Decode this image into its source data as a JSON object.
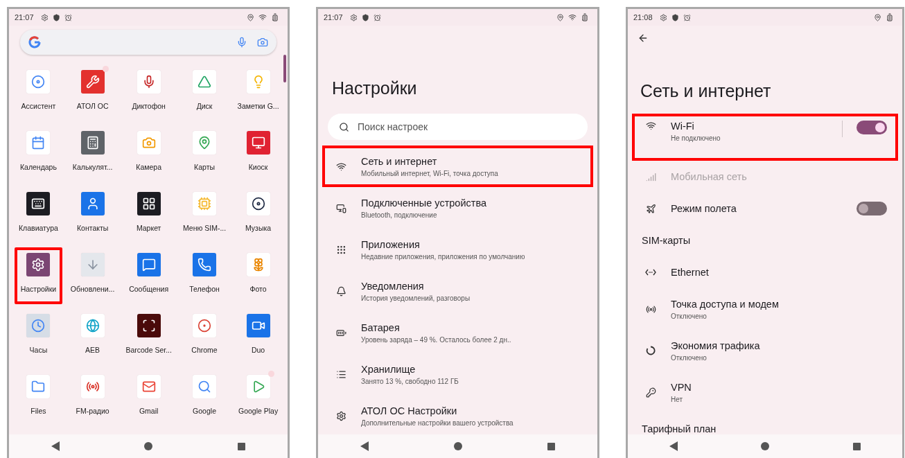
{
  "screens": [
    {
      "kind": "launcher",
      "status_bar": {
        "time": "21:07",
        "wifi": true
      },
      "scrollbar": true,
      "apps": [
        {
          "label": "Ассистент",
          "highlighted": false,
          "dot": false
        },
        {
          "label": "АТОЛ ОС",
          "highlighted": false,
          "dot": true
        },
        {
          "label": "Диктофон",
          "highlighted": false,
          "dot": false
        },
        {
          "label": "Диск",
          "highlighted": false,
          "dot": false
        },
        {
          "label": "Заметки G...",
          "highlighted": false,
          "dot": false
        },
        {
          "label": "Календарь",
          "highlighted": false,
          "dot": false
        },
        {
          "label": "Калькулят...",
          "highlighted": false,
          "dot": false
        },
        {
          "label": "Камера",
          "highlighted": false,
          "dot": false
        },
        {
          "label": "Карты",
          "highlighted": false,
          "dot": false
        },
        {
          "label": "Киоск",
          "highlighted": false,
          "dot": false
        },
        {
          "label": "Клавиатура",
          "highlighted": false,
          "dot": false
        },
        {
          "label": "Контакты",
          "highlighted": false,
          "dot": false
        },
        {
          "label": "Маркет",
          "highlighted": false,
          "dot": false
        },
        {
          "label": "Меню SIM-...",
          "highlighted": false,
          "dot": false
        },
        {
          "label": "Музыка",
          "highlighted": false,
          "dot": false
        },
        {
          "label": "Настройки",
          "highlighted": true,
          "dot": false
        },
        {
          "label": "Обновлени...",
          "highlighted": false,
          "dot": false
        },
        {
          "label": "Сообщения",
          "highlighted": false,
          "dot": false
        },
        {
          "label": "Телефон",
          "highlighted": false,
          "dot": false
        },
        {
          "label": "Фото",
          "highlighted": false,
          "dot": false
        },
        {
          "label": "Часы",
          "highlighted": false,
          "dot": false
        },
        {
          "label": "AEB",
          "highlighted": false,
          "dot": false
        },
        {
          "label": "Barcode Ser...",
          "highlighted": false,
          "dot": false
        },
        {
          "label": "Chrome",
          "highlighted": false,
          "dot": false
        },
        {
          "label": "Duo",
          "highlighted": false,
          "dot": false
        },
        {
          "label": "Files",
          "highlighted": false,
          "dot": false
        },
        {
          "label": "FM-радио",
          "highlighted": false,
          "dot": false
        },
        {
          "label": "Gmail",
          "highlighted": false,
          "dot": false
        },
        {
          "label": "Google",
          "highlighted": false,
          "dot": false
        },
        {
          "label": "Google Play",
          "highlighted": false,
          "dot": true
        }
      ]
    },
    {
      "kind": "settings",
      "status_bar": {
        "time": "21:07",
        "wifi": true
      },
      "title": "Настройки",
      "search": {
        "placeholder": "Поиск настроек"
      },
      "items": [
        {
          "title": "Сеть и интернет",
          "subtitle": "Мобильный интернет, Wi-Fi, точка доступа",
          "highlighted": true
        },
        {
          "title": "Подключенные устройства",
          "subtitle": "Bluetooth, подключение",
          "highlighted": false
        },
        {
          "title": "Приложения",
          "subtitle": "Недавние приложения, приложения по умолчанию",
          "highlighted": false
        },
        {
          "title": "Уведомления",
          "subtitle": "История уведомлений, разговоры",
          "highlighted": false
        },
        {
          "title": "Батарея",
          "subtitle": "Уровень заряда – 49 %. Осталось более 2 дн..",
          "highlighted": false
        },
        {
          "title": "Хранилище",
          "subtitle": "Занято 13 %, свободно 112 ГБ",
          "highlighted": false
        },
        {
          "title": "АТОЛ ОС Настройки",
          "subtitle": "Дополнительные настройки вашего устройства",
          "highlighted": false
        }
      ]
    },
    {
      "kind": "network",
      "status_bar": {
        "time": "21:08",
        "wifi": false
      },
      "title": "Сеть и интернет",
      "items": [
        {
          "kind": "toggle",
          "title": "Wi-Fi",
          "subtitle": "Не подключено",
          "on": true,
          "highlighted": true,
          "disabled": false
        },
        {
          "kind": "entry",
          "title": "Мобильная сеть",
          "highlighted": false,
          "disabled": true
        },
        {
          "kind": "toggle",
          "title": "Режим полета",
          "on": false,
          "highlighted": false,
          "disabled": false
        },
        {
          "kind": "header",
          "title": "SIM-карты"
        },
        {
          "kind": "entry",
          "title": "Ethernet",
          "highlighted": false,
          "disabled": false
        },
        {
          "kind": "entry",
          "title": "Точка доступа и модем",
          "subtitle": "Отключено",
          "highlighted": false,
          "disabled": false
        },
        {
          "kind": "entry",
          "title": "Экономия трафика",
          "subtitle": "Отключено",
          "highlighted": false,
          "disabled": false
        },
        {
          "kind": "entry",
          "title": "VPN",
          "subtitle": "Нет",
          "highlighted": false,
          "disabled": false
        },
        {
          "kind": "header",
          "title": "Тарифный план"
        }
      ]
    }
  ]
}
